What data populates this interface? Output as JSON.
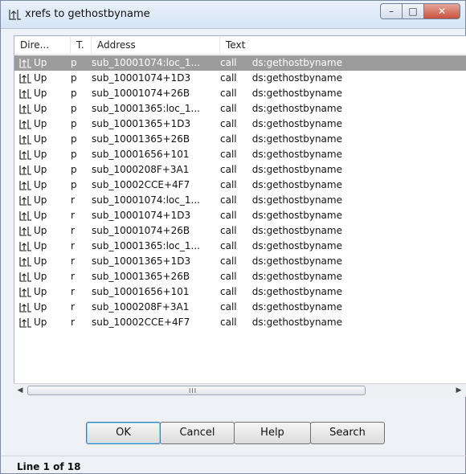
{
  "window": {
    "title": "xrefs to gethostbyname",
    "title_icon": "xrefs-icon"
  },
  "columns": [
    "Dire...",
    "T.",
    "Address",
    "Text"
  ],
  "rows": [
    {
      "dir": "Up",
      "type": "p",
      "address": "sub_10001074:loc_1...",
      "instr": "call",
      "operand": "ds:gethostbyname"
    },
    {
      "dir": "Up",
      "type": "p",
      "address": "sub_10001074+1D3",
      "instr": "call",
      "operand": "ds:gethostbyname"
    },
    {
      "dir": "Up",
      "type": "p",
      "address": "sub_10001074+26B",
      "instr": "call",
      "operand": "ds:gethostbyname"
    },
    {
      "dir": "Up",
      "type": "p",
      "address": "sub_10001365:loc_1...",
      "instr": "call",
      "operand": "ds:gethostbyname"
    },
    {
      "dir": "Up",
      "type": "p",
      "address": "sub_10001365+1D3",
      "instr": "call",
      "operand": "ds:gethostbyname"
    },
    {
      "dir": "Up",
      "type": "p",
      "address": "sub_10001365+26B",
      "instr": "call",
      "operand": "ds:gethostbyname"
    },
    {
      "dir": "Up",
      "type": "p",
      "address": "sub_10001656+101",
      "instr": "call",
      "operand": "ds:gethostbyname"
    },
    {
      "dir": "Up",
      "type": "p",
      "address": "sub_1000208F+3A1",
      "instr": "call",
      "operand": "ds:gethostbyname"
    },
    {
      "dir": "Up",
      "type": "p",
      "address": "sub_10002CCE+4F7",
      "instr": "call",
      "operand": "ds:gethostbyname"
    },
    {
      "dir": "Up",
      "type": "r",
      "address": "sub_10001074:loc_1...",
      "instr": "call",
      "operand": "ds:gethostbyname"
    },
    {
      "dir": "Up",
      "type": "r",
      "address": "sub_10001074+1D3",
      "instr": "call",
      "operand": "ds:gethostbyname"
    },
    {
      "dir": "Up",
      "type": "r",
      "address": "sub_10001074+26B",
      "instr": "call",
      "operand": "ds:gethostbyname"
    },
    {
      "dir": "Up",
      "type": "r",
      "address": "sub_10001365:loc_1...",
      "instr": "call",
      "operand": "ds:gethostbyname"
    },
    {
      "dir": "Up",
      "type": "r",
      "address": "sub_10001365+1D3",
      "instr": "call",
      "operand": "ds:gethostbyname"
    },
    {
      "dir": "Up",
      "type": "r",
      "address": "sub_10001365+26B",
      "instr": "call",
      "operand": "ds:gethostbyname"
    },
    {
      "dir": "Up",
      "type": "r",
      "address": "sub_10001656+101",
      "instr": "call",
      "operand": "ds:gethostbyname"
    },
    {
      "dir": "Up",
      "type": "r",
      "address": "sub_1000208F+3A1",
      "instr": "call",
      "operand": "ds:gethostbyname"
    },
    {
      "dir": "Up",
      "type": "r",
      "address": "sub_10002CCE+4F7",
      "instr": "call",
      "operand": "ds:gethostbyname"
    }
  ],
  "selected_row": 0,
  "buttons": {
    "ok": "OK",
    "cancel": "Cancel",
    "help": "Help",
    "search": "Search"
  },
  "status": "Line 1 of 18",
  "scroll_grip": "III",
  "colors": {
    "selection": "#9c9c9c",
    "close_button": "#c9513c"
  }
}
